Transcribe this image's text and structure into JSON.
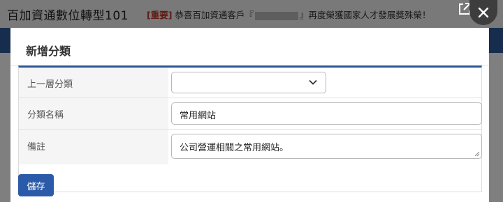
{
  "background": {
    "app_title": "百加資通數位轉型101",
    "marquee": {
      "tag": "[重要]",
      "text_before": "恭喜百加資通客戶『",
      "text_after": "』再度榮獲國家人才發展獎殊榮！"
    }
  },
  "controls": {
    "popout_icon": "external-link-icon",
    "close_icon": "close-icon"
  },
  "modal": {
    "title": "新增分類",
    "fields": [
      {
        "label": "上一層分類",
        "type": "select",
        "value": ""
      },
      {
        "label": "分類名稱",
        "type": "text",
        "value": "常用網站"
      },
      {
        "label": "備註",
        "type": "textarea",
        "value": "公司營運相關之常用網站。"
      }
    ],
    "save_label": "儲存"
  },
  "colors": {
    "accent": "#2b5597",
    "button": "#2b5ba8",
    "alert_tag": "#c0392b"
  }
}
